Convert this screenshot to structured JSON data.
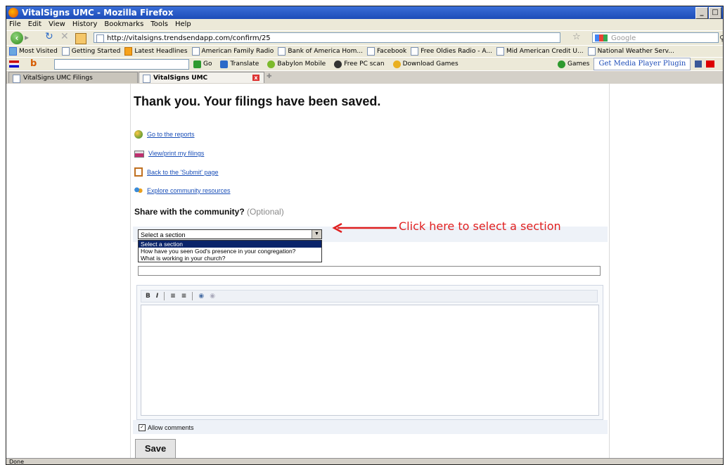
{
  "window": {
    "title": "VitalSigns UMC - Mozilla Firefox",
    "controls": [
      "_",
      "□",
      "×"
    ]
  },
  "menu": [
    "File",
    "Edit",
    "View",
    "History",
    "Bookmarks",
    "Tools",
    "Help"
  ],
  "nav": {
    "url": "http://vitalsigns.trendsendapp.com/confirm/25",
    "search_placeholder": "Google"
  },
  "bookmarks": [
    {
      "label": "Most Visited",
      "icon": "most-visited-icon"
    },
    {
      "label": "Getting Started",
      "icon": "page-icon"
    },
    {
      "label": "Latest Headlines",
      "icon": "rss-icon"
    },
    {
      "label": "American Family Radio",
      "icon": "page-icon"
    },
    {
      "label": "Bank of America Hom...",
      "icon": "page-icon"
    },
    {
      "label": "Facebook",
      "icon": "page-icon"
    },
    {
      "label": "Free Oldies Radio - A...",
      "icon": "page-icon"
    },
    {
      "label": "Mid American Credit U...",
      "icon": "page-icon"
    },
    {
      "label": "National Weather Serv...",
      "icon": "page-icon"
    }
  ],
  "toolbar2": {
    "go": "Go",
    "translate": "Translate",
    "babylon": "Babylon Mobile",
    "pcscan": "Free PC scan",
    "download": "Download Games",
    "games": "Games",
    "plugin": "Get Media Player Plugin"
  },
  "tabs": [
    {
      "label": "VitalSigns UMC Filings",
      "active": false
    },
    {
      "label": "VitalSigns UMC",
      "active": true
    }
  ],
  "page": {
    "title": "Thank you. Your filings have been saved.",
    "links": [
      {
        "label": "Go to the reports",
        "icon": "globe-icon"
      },
      {
        "label": "View/print my filings",
        "icon": "printer-icon"
      },
      {
        "label": "Back to the 'Submit' page",
        "icon": "clipboard-icon"
      },
      {
        "label": "Explore community resources",
        "icon": "people-icon"
      }
    ],
    "share_heading": "Share with the community?",
    "share_optional": "(Optional)",
    "select_value": "Select a section",
    "select_options": [
      "Select a section",
      "How have you seen God's presence in your congregation?",
      "What is working in your church?"
    ],
    "editor_buttons": [
      "B",
      "I"
    ],
    "allow_comments": "Allow comments",
    "allow_checked": true,
    "save": "Save"
  },
  "annotation": {
    "text": "Click here to select a section",
    "color": "#e02020"
  },
  "status": "Done"
}
